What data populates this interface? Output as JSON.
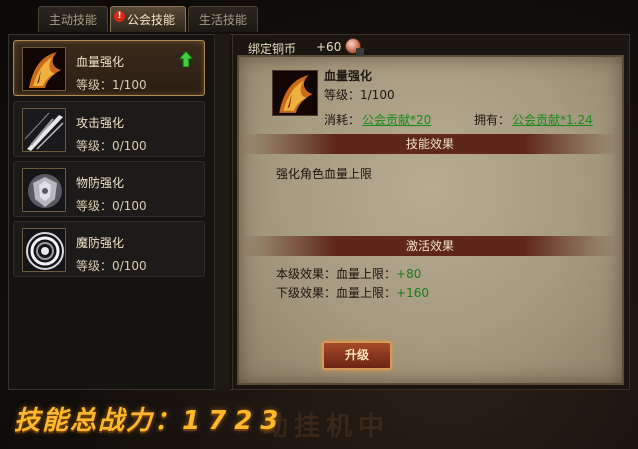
{
  "tabs": [
    {
      "label": "主动技能"
    },
    {
      "label": "公会技能",
      "alert": "!"
    },
    {
      "label": "生活技能"
    }
  ],
  "skills": [
    {
      "name": "血量强化",
      "level": "等级：1/100",
      "icon": "blood-claw-icon"
    },
    {
      "name": "攻击强化",
      "level": "等级：0/100",
      "icon": "sword-slash-icon"
    },
    {
      "name": "物防强化",
      "level": "等级：0/100",
      "icon": "armor-shield-icon"
    },
    {
      "name": "魔防强化",
      "level": "等级：0/100",
      "icon": "magic-ward-icon"
    }
  ],
  "detail": {
    "coin_label": "绑定铜币",
    "coin_value": "+60",
    "skill_name": "血量强化",
    "skill_level": "等级：1/100",
    "cost_label": "消耗：",
    "cost_value": "公会贡献*20",
    "own_label": "拥有：",
    "own_value": "公会贡献*1.24",
    "effect_header": "技能效果",
    "effect_text": "强化角色血量上限",
    "activate_header": "激活效果",
    "this_level_label": "本级效果：血量上限：",
    "this_level_value": "+80",
    "next_level_label": "下级效果：血量上限：",
    "next_level_value": "+160",
    "upgrade_label": "升级"
  },
  "footer": {
    "power_label": "技能总战力：",
    "power_value": "1723",
    "watermark": "动挂机中"
  },
  "colors": {
    "accent_gold": "#ffb82a",
    "link_green": "#1c8a1c",
    "header_red": "#5a2012"
  }
}
